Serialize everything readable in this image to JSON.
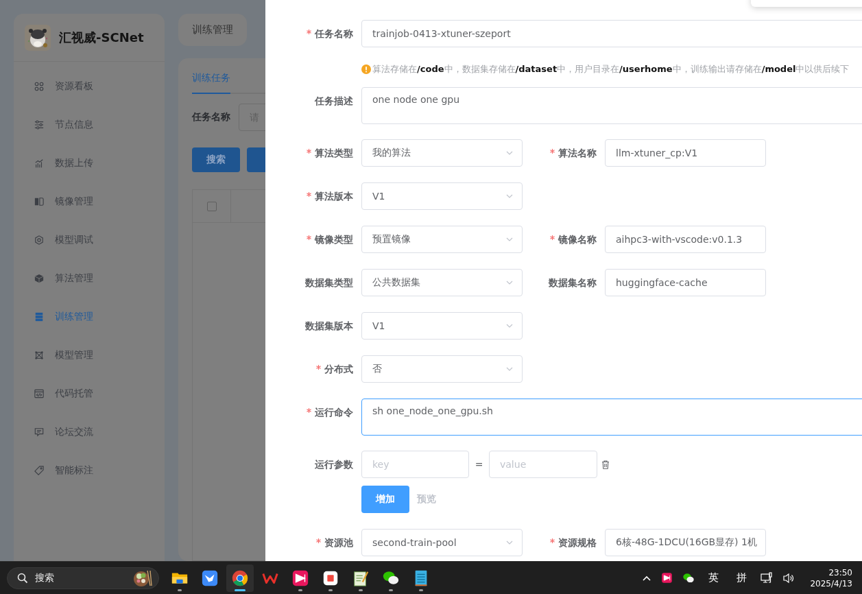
{
  "sidebar": {
    "title": "汇视威-SCNet",
    "items": [
      {
        "label": "资源看板",
        "selected": false
      },
      {
        "label": "节点信息",
        "selected": false
      },
      {
        "label": "数据上传",
        "selected": false
      },
      {
        "label": "镜像管理",
        "selected": false
      },
      {
        "label": "模型调试",
        "selected": false
      },
      {
        "label": "算法管理",
        "selected": false
      },
      {
        "label": "训练管理",
        "selected": true
      },
      {
        "label": "模型管理",
        "selected": false
      },
      {
        "label": "代码托管",
        "selected": false
      },
      {
        "label": "论坛交流",
        "selected": false
      },
      {
        "label": "智能标注",
        "selected": false
      }
    ]
  },
  "breadcrumb": "训练管理",
  "main": {
    "tabs": [
      {
        "label": "训练任务",
        "selected": true
      }
    ],
    "filter": {
      "label": "任务名称",
      "placeholder": "请"
    },
    "buttons": [
      {
        "kind": "primary",
        "label": "搜索"
      },
      {
        "kind": "primary"
      }
    ],
    "table": {
      "header_checkbox": {
        "checked": false
      }
    }
  },
  "drawer": {
    "rows": [
      {
        "kind": "fields",
        "fields": [
          {
            "kind": "text",
            "label": "任务名称",
            "required": true,
            "value": "trainjob-0413-xtuner-szeport"
          }
        ]
      },
      {
        "kind": "hint",
        "text": "算法存储在**/code**中，数据集存储在**/dataset**中，用户目录在**/userhome**中，训练输出请存储在**/model**中以供后续下"
      },
      {
        "kind": "fields",
        "fields": [
          {
            "kind": "textarea",
            "label": "任务描述",
            "required": false,
            "value": "one node one gpu",
            "focused": false
          }
        ]
      },
      {
        "kind": "fields",
        "fields": [
          {
            "kind": "select",
            "label": "算法类型",
            "required": true,
            "value": "我的算法"
          },
          {
            "kind": "input",
            "label": "算法名称",
            "required": true,
            "value": "llm-xtuner_cp:V1"
          }
        ]
      },
      {
        "kind": "fields",
        "fields": [
          {
            "kind": "select",
            "label": "算法版本",
            "required": true,
            "value": "V1"
          }
        ]
      },
      {
        "kind": "fields",
        "fields": [
          {
            "kind": "select",
            "label": "镜像类型",
            "required": true,
            "value": "预置镜像"
          },
          {
            "kind": "input",
            "label": "镜像名称",
            "required": true,
            "value": "aihpc3-with-vscode:v0.1.3"
          }
        ]
      },
      {
        "kind": "fields",
        "fields": [
          {
            "kind": "select",
            "label": "数据集类型",
            "required": false,
            "value": "公共数据集"
          },
          {
            "kind": "input",
            "label": "数据集名称",
            "required": false,
            "value": "huggingface-cache"
          }
        ]
      },
      {
        "kind": "fields",
        "fields": [
          {
            "kind": "select",
            "label": "数据集版本",
            "required": false,
            "value": "V1"
          }
        ]
      },
      {
        "kind": "fields",
        "fields": [
          {
            "kind": "select",
            "label": "分布式",
            "required": true,
            "value": "否"
          }
        ]
      },
      {
        "kind": "fields",
        "fields": [
          {
            "kind": "textarea",
            "label": "运行命令",
            "required": true,
            "value": "sh one_node_one_gpu.sh",
            "focused": true
          }
        ]
      },
      {
        "kind": "params",
        "label": "运行参数",
        "required": false,
        "key_placeholder": "key",
        "separator": "=",
        "value_placeholder": "value"
      },
      {
        "kind": "actions",
        "buttons": [
          {
            "kind": "primary",
            "label": "增加",
            "disabled": false
          },
          {
            "kind": "text",
            "label": "预览",
            "disabled": true
          }
        ]
      },
      {
        "kind": "fields",
        "fields": [
          {
            "kind": "select",
            "label": "资源池",
            "required": true,
            "value": "second-train-pool"
          },
          {
            "kind": "select",
            "label": "资源规格",
            "required": true,
            "value": "6核-48G-1DCU(16GB显存) 1机"
          }
        ]
      }
    ]
  },
  "taskbar": {
    "search": {
      "placeholder": "搜索"
    },
    "apps": [
      {
        "kind": "folder",
        "running": true,
        "selected": false
      },
      {
        "kind": "bird",
        "running": false,
        "selected": false
      },
      {
        "kind": "browser",
        "running": true,
        "selected": true
      },
      {
        "kind": "zigzag",
        "running": false,
        "selected": false
      },
      {
        "kind": "pink",
        "running": true,
        "selected": false
      },
      {
        "kind": "redsquare",
        "running": true,
        "selected": false
      },
      {
        "kind": "notepad",
        "running": true,
        "selected": false
      },
      {
        "kind": "chat",
        "running": true,
        "selected": false
      },
      {
        "kind": "notebook",
        "running": true,
        "selected": false
      }
    ],
    "tray": {
      "input_lang": "英",
      "input_mode": "拼",
      "time": "23:50",
      "date": "2025/4/13"
    }
  }
}
